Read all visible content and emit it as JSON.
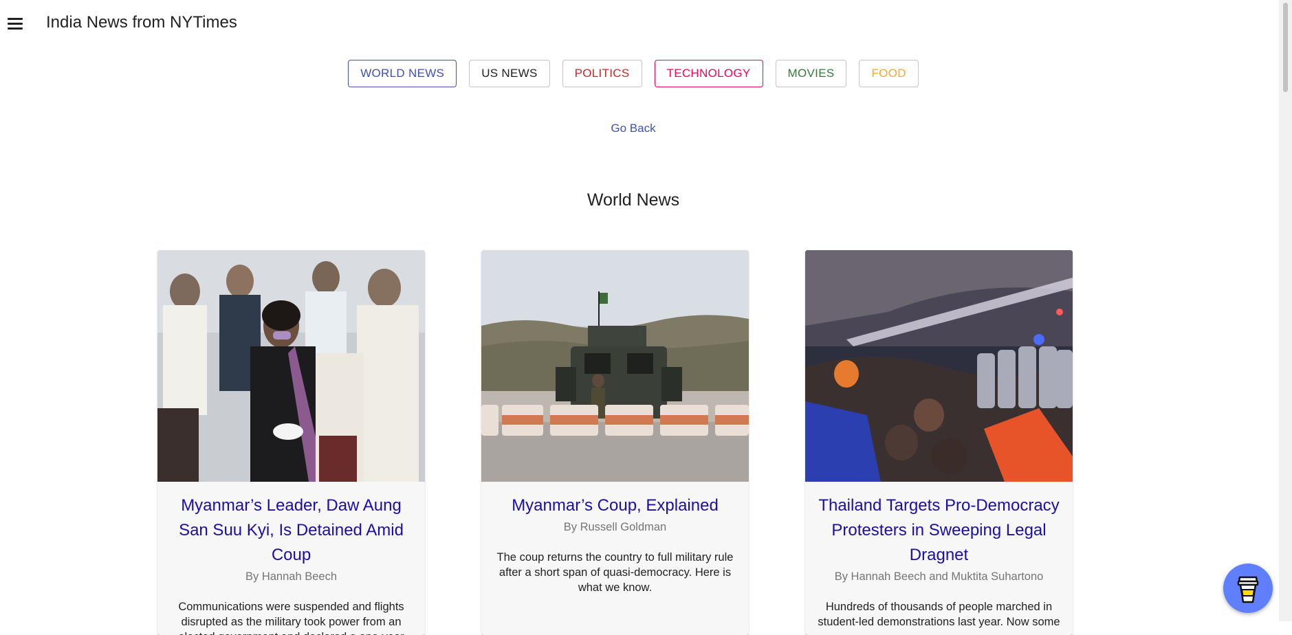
{
  "app": {
    "title": "India News from NYTimes"
  },
  "categories": [
    {
      "label": "WORLD NEWS",
      "color": "#3f51b5",
      "border": "#3f51b5"
    },
    {
      "label": "US NEWS",
      "color": "#212121",
      "border": "rgba(0,0,0,0.23)"
    },
    {
      "label": "POLITICS",
      "color": "#c62828",
      "border": "rgba(0,0,0,0.23)"
    },
    {
      "label": "TECHNOLOGY",
      "color": "#f50057",
      "border": "#f50057"
    },
    {
      "label": "MOVIES",
      "color": "#2e7d32",
      "border": "rgba(0,0,0,0.23)"
    },
    {
      "label": "FOOD",
      "color": "#f9a825",
      "border": "rgba(0,0,0,0.23)"
    }
  ],
  "nav": {
    "go_back": "Go Back"
  },
  "section": {
    "title": "World News"
  },
  "articles": [
    {
      "title": "Myanmar’s Leader, Daw Aung San Suu Kyi, Is Detained Amid Coup",
      "byline": "By Hannah Beech",
      "abstract": "Communications were suspended and flights disrupted as the military took power from an elected government and declared a one-year"
    },
    {
      "title": "Myanmar’s Coup, Explained",
      "byline": "By Russell Goldman",
      "abstract": "The coup returns the country to full military rule after a short span of quasi-democracy. Here is what we know."
    },
    {
      "title": "Thailand Targets Pro-Democracy Protesters in Sweeping Legal Dragnet",
      "byline": "By Hannah Beech and Muktita Suhartono",
      "abstract": "Hundreds of thousands of people marched in student-led demonstrations last year. Now some"
    }
  ],
  "theme": {
    "link_color": "#1a0dab",
    "accent": "#3f51b5",
    "fab_color": "#5f7fff"
  },
  "icons": {
    "menu": "hamburger-menu-icon",
    "fab": "coffee-cup-icon"
  }
}
